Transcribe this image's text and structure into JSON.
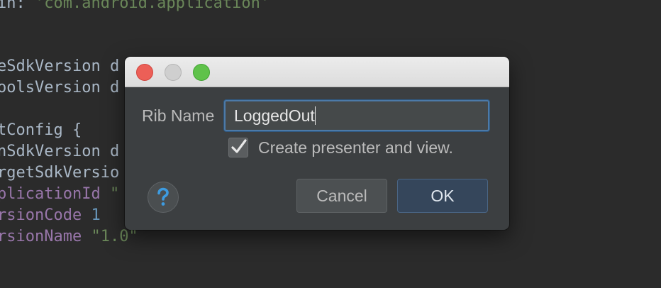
{
  "editor": {
    "lines": [
      {
        "name": "line-apply-plugin",
        "parts": [
          {
            "text": "in: ",
            "cls": ""
          },
          {
            "text": "'com.android.application'",
            "cls": "tok-str"
          }
        ]
      },
      {
        "name": "line-compile-sdk",
        "parts": [
          {
            "text": "eSdkVersion d",
            "cls": ""
          }
        ]
      },
      {
        "name": "line-build-tools",
        "parts": [
          {
            "text": "oolsVersion d",
            "cls": ""
          }
        ]
      },
      {
        "name": "line-default-config",
        "parts": [
          {
            "text": "tConfig {",
            "cls": ""
          }
        ]
      },
      {
        "name": "line-min-sdk",
        "parts": [
          {
            "text": "nSdkVersion d",
            "cls": ""
          }
        ]
      },
      {
        "name": "line-target-sdk",
        "parts": [
          {
            "text": "rgetSdkVersio",
            "cls": ""
          }
        ]
      },
      {
        "name": "line-application-id",
        "parts": [
          {
            "text": "plicationId ",
            "cls": "tok-prop"
          },
          {
            "text": "\"",
            "cls": "tok-str"
          }
        ]
      },
      {
        "name": "line-version-code",
        "parts": [
          {
            "text": "rsionCode ",
            "cls": "tok-prop"
          },
          {
            "text": "1",
            "cls": "tok-num"
          }
        ]
      },
      {
        "name": "line-version-name",
        "parts": [
          {
            "text": "rsionName ",
            "cls": "tok-prop"
          },
          {
            "text": "\"1.0\"",
            "cls": "tok-str"
          }
        ]
      }
    ]
  },
  "dialog": {
    "rib_name_label": "Rib Name",
    "rib_name_value": "LoggedOut",
    "checkbox_label": "Create presenter and view.",
    "checkbox_checked": true,
    "help_icon": "question-icon",
    "cancel_label": "Cancel",
    "ok_label": "OK"
  },
  "colors": {
    "editor_bg": "#2b2b2b",
    "dialog_bg": "#3c3f41",
    "focus_border": "#4c7aa8",
    "ok_button_bg": "#35465b",
    "help_icon_color": "#3d9be0"
  }
}
